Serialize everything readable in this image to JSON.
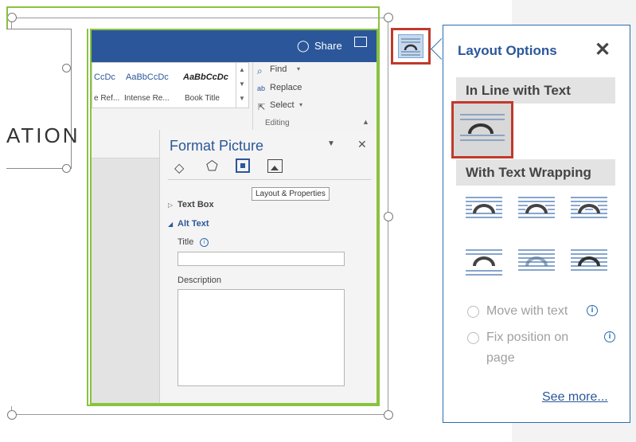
{
  "word_window": {
    "share_label": "Share",
    "styles": [
      {
        "preview": "CcDc",
        "name": "e Ref..."
      },
      {
        "preview": "AaBbCcDc",
        "name": "Intense Re..."
      },
      {
        "preview": "AaBbCcDc",
        "name": "Book Title"
      }
    ],
    "editing": {
      "find_label": "Find",
      "replace_label": "Replace",
      "select_label": "Select",
      "group_label": "Editing"
    },
    "doc_text": "ATION"
  },
  "format_picture": {
    "title": "Format Picture",
    "tooltip": "Layout & Properties",
    "text_box_label": "Text Box",
    "alt_text_label": "Alt Text",
    "title_field_label": "Title",
    "title_value": "",
    "description_label": "Description",
    "description_value": ""
  },
  "layout_options": {
    "title": "Layout Options",
    "close_glyph": "✕",
    "in_line_section": "In Line with Text",
    "wrapping_section": "With Text Wrapping",
    "wrap_options": [
      "Square",
      "Tight",
      "Through",
      "Top and Bottom",
      "Behind Text",
      "In Front of Text"
    ],
    "move_with_text": "Move with text",
    "fix_position_line1": "Fix position on",
    "fix_position_line2": "page",
    "see_more": "See more..."
  },
  "colors": {
    "accent": "#2b579a",
    "selection_green": "#8ac23e",
    "highlight_red": "#c0392b"
  }
}
